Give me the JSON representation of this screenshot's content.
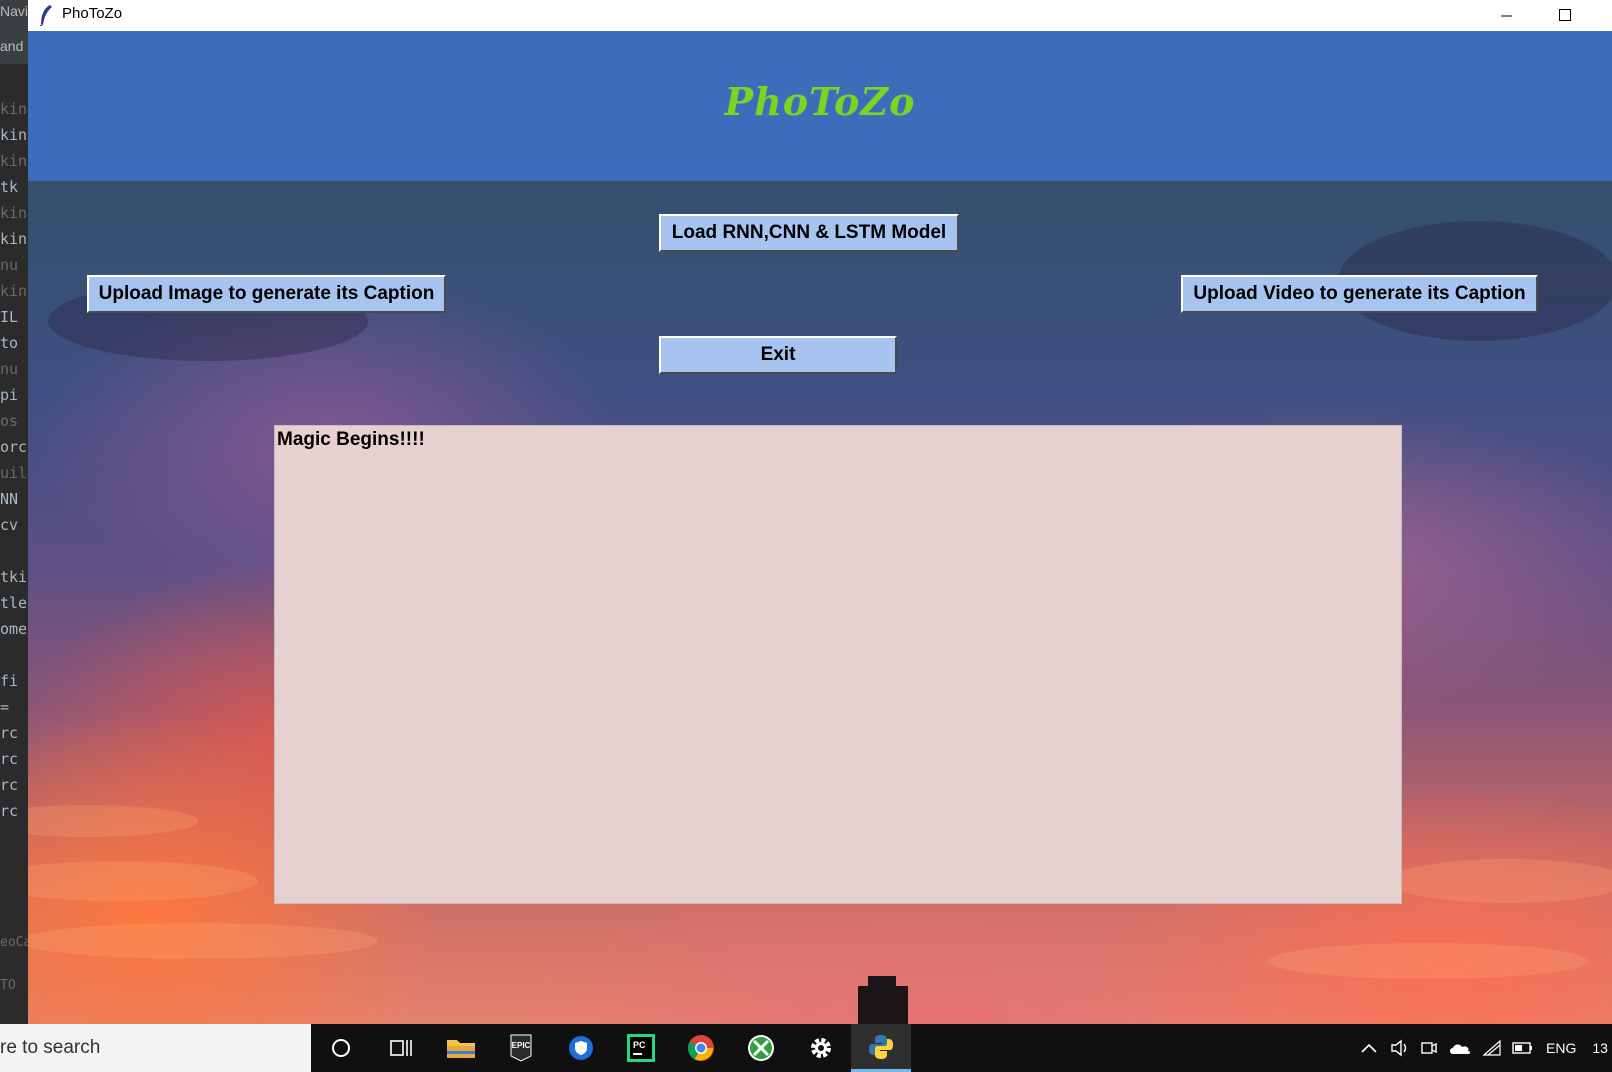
{
  "window": {
    "title": "PhoToZo"
  },
  "header": {
    "logo_text": "PhoToZo"
  },
  "buttons": {
    "load_model": "Load RNN,CNN & LSTM Model",
    "upload_image": "Upload Image to generate its Caption",
    "upload_video": "Upload Video to generate its Caption",
    "exit": "Exit"
  },
  "output": {
    "text": "Magic Begins!!!!"
  },
  "taskbar": {
    "search_placeholder": "re to search",
    "apps": [
      "cortana-circle",
      "task-view",
      "file-explorer",
      "epic-games",
      "shield",
      "pycharm",
      "chrome",
      "xbox",
      "settings",
      "python"
    ],
    "tray": {
      "language": "ENG",
      "clock_fragment": "13"
    }
  },
  "editor_strip": {
    "top_lines": [
      "Navi",
      "and"
    ],
    "code_fragments": [
      "kin",
      "kin",
      "kin",
      "tk",
      "kin",
      "kin",
      "nu",
      "kin",
      "IL",
      "to",
      "nu",
      "pi",
      "os",
      "orc",
      "uil",
      "NN",
      "cv",
      "tki",
      "tle",
      "ome",
      "fi",
      "=",
      "rc",
      "rc",
      "rc",
      "rc"
    ],
    "bottom_lines": [
      "eoCa",
      "TO"
    ]
  },
  "colors": {
    "header_bg": "#3d6dba",
    "logo": "#7ed321",
    "button_bg": "#a6c4ef",
    "textbox_bg": "#e7d0d0"
  }
}
